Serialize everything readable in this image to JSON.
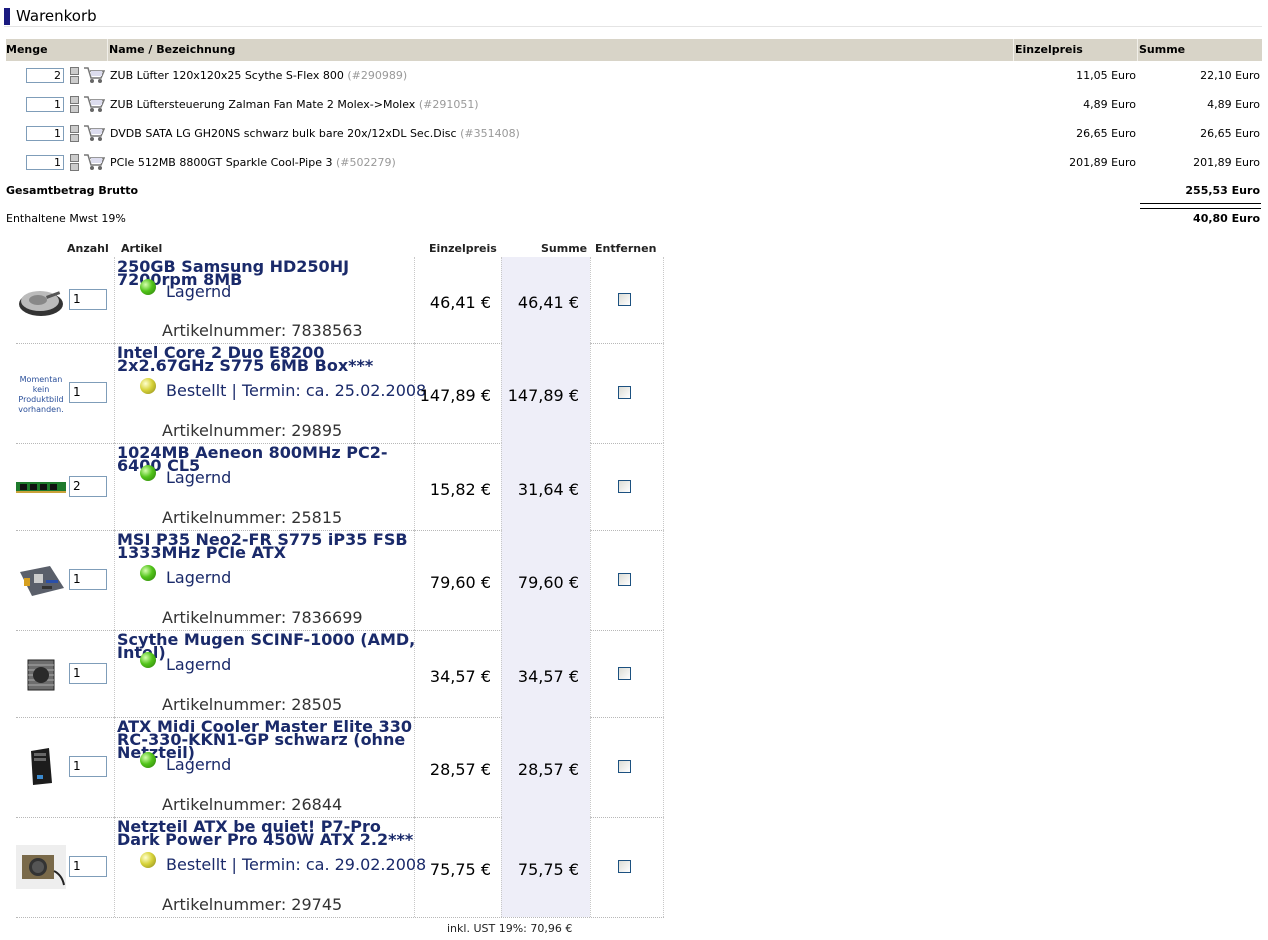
{
  "header": {
    "title": "Warenkorb"
  },
  "cart": {
    "columns": {
      "menge": "Menge",
      "name": "Name / Bezeichnung",
      "einzelpreis": "Einzelpreis",
      "summe": "Summe"
    },
    "rows": [
      {
        "qty": "2",
        "name": "ZUB Lüfter 120x120x25 Scythe S-Flex 800",
        "nr": "(#290989)",
        "einzelpreis": "11,05 Euro",
        "summe": "22,10 Euro"
      },
      {
        "qty": "1",
        "name": "ZUB Lüftersteuerung Zalman Fan Mate 2 Molex->Molex",
        "nr": "(#291051)",
        "einzelpreis": "4,89 Euro",
        "summe": "4,89 Euro"
      },
      {
        "qty": "1",
        "name": "DVDB SATA LG GH20NS schwarz bulk bare 20x/12xDL Sec.Disc",
        "nr": "(#351408)",
        "einzelpreis": "26,65 Euro",
        "summe": "26,65 Euro"
      },
      {
        "qty": "1",
        "name": "PCIe 512MB 8800GT Sparkle Cool-Pipe 3",
        "nr": "(#502279)",
        "einzelpreis": "201,89 Euro",
        "summe": "201,89 Euro"
      }
    ],
    "total_label": "Gesamtbetrag Brutto",
    "total_value": "255,53 Euro",
    "mwst_label": "Enthaltene Mwst 19%",
    "mwst_value": "40,80 Euro"
  },
  "basket": {
    "columns": {
      "anzahl": "Anzahl",
      "artikel": "Artikel",
      "einzelpreis": "Einzelpreis",
      "summe": "Summe",
      "entfernen": "Entfernen"
    },
    "no_image_text": [
      "Momentan",
      "kein",
      "Produktbild",
      "vorhanden."
    ],
    "items": [
      {
        "title": "250GB Samsung HD250HJ 7200rpm 8MB",
        "qty": "1",
        "status": "Lagernd",
        "status_color": "green",
        "artnr": "Artikelnummer: 7838563",
        "einzelpreis": "46,41 €",
        "summe": "46,41 €",
        "thumb": "hdd-image"
      },
      {
        "title": "Intel Core 2 Duo E8200 2x2.67GHz S775 6MB Box***",
        "qty": "1",
        "status": "Bestellt | Termin: ca. 25.02.2008",
        "status_color": "yellow",
        "artnr": "Artikelnummer: 29895",
        "einzelpreis": "147,89 €",
        "summe": "147,89 €",
        "thumb": "no-image"
      },
      {
        "title": "1024MB Aeneon 800MHz PC2-6400 CL5",
        "qty": "2",
        "status": "Lagernd",
        "status_color": "green",
        "artnr": "Artikelnummer: 25815",
        "einzelpreis": "15,82 €",
        "summe": "31,64 €",
        "thumb": "ram-image"
      },
      {
        "title": "MSI P35 Neo2-FR S775 iP35 FSB 1333MHz PCIe ATX",
        "qty": "1",
        "status": "Lagernd",
        "status_color": "green",
        "artnr": "Artikelnummer: 7836699",
        "einzelpreis": "79,60 €",
        "summe": "79,60 €",
        "thumb": "mainboard-image"
      },
      {
        "title": "Scythe Mugen SCINF-1000 (AMD, Intel)",
        "qty": "1",
        "status": "Lagernd",
        "status_color": "green",
        "artnr": "Artikelnummer: 28505",
        "einzelpreis": "34,57 €",
        "summe": "34,57 €",
        "thumb": "cooler-image"
      },
      {
        "title": "ATX Midi Cooler Master Elite 330 RC-330-KKN1-GP schwarz (ohne Netzteil)",
        "qty": "1",
        "status": "Lagernd",
        "status_color": "green",
        "artnr": "Artikelnummer: 26844",
        "einzelpreis": "28,57 €",
        "summe": "28,57 €",
        "thumb": "case-image"
      },
      {
        "title": "Netzteil ATX be quiet! P7-Pro Dark Power Pro 450W ATX 2.2***",
        "qty": "1",
        "status": "Bestellt | Termin: ca. 29.02.2008",
        "status_color": "yellow",
        "artnr": "Artikelnummer: 29745",
        "einzelpreis": "75,75 €",
        "summe": "75,75 €",
        "thumb": "psu-image"
      }
    ],
    "tax_line": "inkl. UST 19%: 70,96 €"
  }
}
